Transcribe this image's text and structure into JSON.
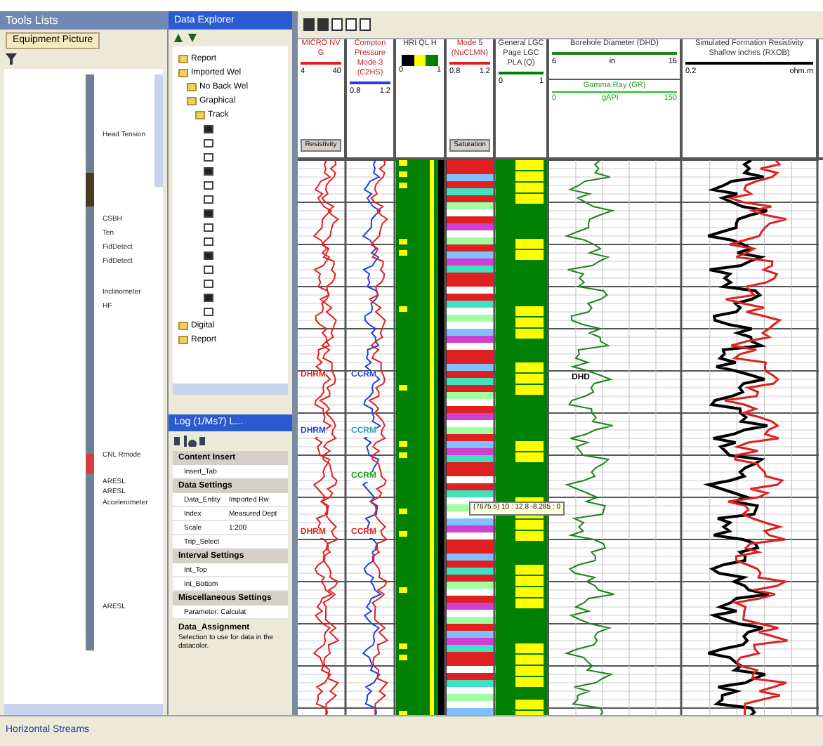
{
  "tools_panel": {
    "title": "Tools Lists",
    "tab": "Equipment Picture",
    "tools": [
      "Head Tension",
      "CSBH",
      "Ten",
      "FidDetect",
      "FidDetect",
      "Inclinometer",
      "HF",
      "CNL Rmode",
      "ARESL",
      "ARESL",
      "Accelerometer",
      "ARESL"
    ]
  },
  "explorer": {
    "title": "Data Explorer",
    "tree": [
      {
        "label": "Report"
      },
      {
        "label": "Imported Wel",
        "children": [
          {
            "label": "No Back Wel"
          },
          {
            "label": "Graphical",
            "children": [
              {
                "label": "Track"
              }
            ]
          }
        ]
      },
      {
        "label": "Digital"
      },
      {
        "label": "Report"
      }
    ]
  },
  "properties": {
    "title": "Log (1/Ms7) L...",
    "sections": [
      {
        "heading": "Content Insert",
        "rows": [
          [
            "Insert_Tab",
            ""
          ]
        ]
      },
      {
        "heading": "Data Settings",
        "rows": [
          [
            "Data_Entity",
            "Imported Rw"
          ],
          [
            "Index",
            "Measured Dept"
          ],
          [
            "Scale",
            "1:200"
          ],
          [
            "Trip_Select",
            ""
          ]
        ]
      },
      {
        "heading": "Interval Settings",
        "rows": [
          [
            "Int_Top",
            ""
          ],
          [
            "Int_Bottom",
            ""
          ]
        ]
      },
      {
        "heading": "Miscellaneous Settings",
        "rows": [
          [
            "Parameter: Calculat",
            ""
          ]
        ]
      }
    ],
    "description_title": "Data_Assignment",
    "description": "Selection to use for data in the datacolor."
  },
  "bottom_bar": {
    "label": "Horizontal Streams"
  },
  "tracks": [
    {
      "kind": "curve",
      "title": "MICRO NV G",
      "range": [
        "4",
        "40"
      ],
      "button": "Resistivity",
      "color": "#e02020"
    },
    {
      "kind": "curve",
      "title": "Compton Pressure Mode 3 (C2HS)",
      "range": [
        "0.8",
        "1.2"
      ],
      "color": "#2040e0"
    },
    {
      "kind": "flags",
      "title": "HRI QL H",
      "range": [
        "0",
        "1"
      ],
      "color": "#008000"
    },
    {
      "kind": "bands",
      "title": "Mode 5 (NuCLMN)",
      "range": [
        "0.8",
        "1.2"
      ],
      "button": "Saturation",
      "color": "#e02020"
    },
    {
      "kind": "flags2",
      "title": "General LGC Page LGC PLA (Q)",
      "range": [
        "0",
        "1"
      ],
      "color": "#008000"
    },
    {
      "kind": "curve",
      "title": "Borehole Diameter (DHD)",
      "range": [
        "6",
        "16"
      ],
      "unit": "in",
      "sub_title": "Gamma Ray (GR)",
      "sub_unit": "gAPI",
      "sub_range": [
        "0",
        "150"
      ],
      "color": "#208020"
    },
    {
      "kind": "curve",
      "title": "Simulated Formation Resistivity Shallow inches (RXOB)",
      "range": [
        "0.2"
      ],
      "unit": "ohm.m",
      "color": "#000000"
    }
  ],
  "curve_labels": [
    {
      "text": "DHRM",
      "color": "#e02020"
    },
    {
      "text": "CCRM",
      "color": "#2040e0"
    },
    {
      "text": "DHRM",
      "color": "#2040e0"
    },
    {
      "text": "CCRM",
      "color": "#20a0c0"
    },
    {
      "text": "CCRM",
      "color": "#20a020"
    },
    {
      "text": "DHRM",
      "color": "#e02020"
    },
    {
      "text": "CCRM",
      "color": "#e02020"
    },
    {
      "text": "DHD",
      "color": "#000000"
    }
  ],
  "tooltip": "(7675.5) 10 : 12.8 -8.285 : 0"
}
